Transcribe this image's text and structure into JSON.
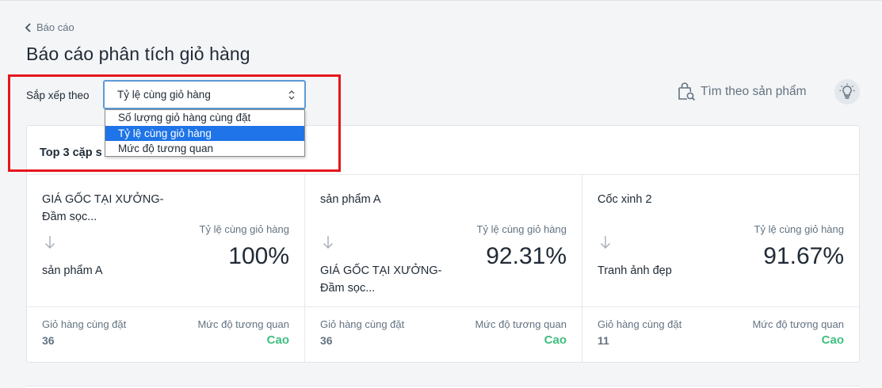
{
  "nav": {
    "back_label": "Báo cáo"
  },
  "page": {
    "title": "Báo cáo phân tích giỏ hàng"
  },
  "sort": {
    "label": "Sắp xếp theo",
    "selected": "Tỷ lệ cùng giỏ hàng",
    "options": [
      "Số lượng giỏ hàng cùng đặt",
      "Tỷ lệ cùng giỏ hàng",
      "Mức độ tương quan"
    ]
  },
  "toolbar": {
    "find_label": "Tìm theo sản phẩm"
  },
  "card": {
    "title": "Top 3 cặp s",
    "pairs": [
      {
        "from": "GIÁ GỐC TẠI XƯỞNG-Đầm sọc...",
        "to": "sản phẩm A",
        "metric_label": "Tỷ lệ cùng giỏ hàng",
        "metric_value": "100%",
        "left_label": "Giỏ hàng cùng đặt",
        "left_value": "36",
        "right_label": "Mức độ tương quan",
        "right_value": "Cao"
      },
      {
        "from": "sản phẩm A",
        "to": "GIÁ GỐC TẠI XƯỞNG-Đầm sọc...",
        "metric_label": "Tỷ lệ cùng giỏ hàng",
        "metric_value": "92.31%",
        "left_label": "Giỏ hàng cùng đặt",
        "left_value": "36",
        "right_label": "Mức độ tương quan",
        "right_value": "Cao"
      },
      {
        "from": "Cốc xinh 2",
        "to": "Tranh ảnh đẹp",
        "metric_label": "Tỷ lệ cùng giỏ hàng",
        "metric_value": "91.67%",
        "left_label": "Giỏ hàng cùng đặt",
        "left_value": "11",
        "right_label": "Mức độ tương quan",
        "right_value": "Cao"
      }
    ]
  },
  "colors": {
    "accent_high": "#3fbf7f",
    "selected_option": "#1e74e8",
    "highlight_border": "#e5161d"
  }
}
